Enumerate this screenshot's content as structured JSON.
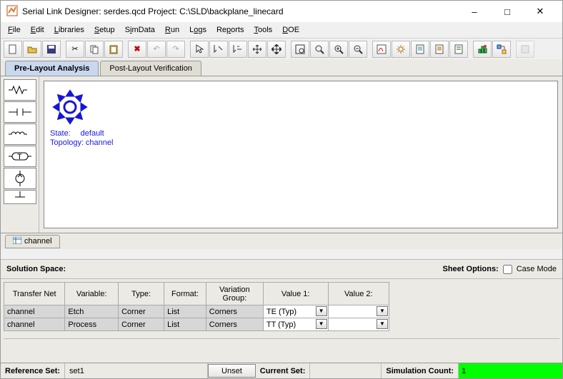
{
  "title": "Serial Link Designer: serdes.qcd Project: C:\\SLD\\backplane_linecard",
  "menus": [
    "File",
    "Edit",
    "Libraries",
    "Setup",
    "SimData",
    "Run",
    "Logs",
    "Reports",
    "Tools",
    "DOE"
  ],
  "tabs": {
    "prelayout": "Pre-Layout Analysis",
    "postlayout": "Post-Layout Verification"
  },
  "canvas": {
    "state_label": "State:",
    "state_value": "default",
    "topo_label": "Topology:",
    "topo_value": "channel"
  },
  "sheet_tab": "channel",
  "solution_space_label": "Solution Space:",
  "sheet_options_label": "Sheet Options:",
  "case_mode_label": "Case Mode",
  "grid": {
    "headers": [
      "Transfer Net",
      "Variable:",
      "Type:",
      "Format:",
      "Variation Group:",
      "Value 1:",
      "Value 2:"
    ],
    "rows": [
      {
        "tnet": "channel",
        "var": "Etch",
        "type": "Corner",
        "fmt": "List",
        "vg": "Corners",
        "v1": "TE (Typ)",
        "v2": ""
      },
      {
        "tnet": "channel",
        "var": "Process",
        "type": "Corner",
        "fmt": "List",
        "vg": "Corners",
        "v1": "TT (Typ)",
        "v2": ""
      }
    ]
  },
  "status": {
    "refset_label": "Reference Set:",
    "refset_value": "set1",
    "unset_btn": "Unset",
    "curset_label": "Current Set:",
    "simcount_label": "Simulation Count:",
    "simcount_value": "1"
  }
}
